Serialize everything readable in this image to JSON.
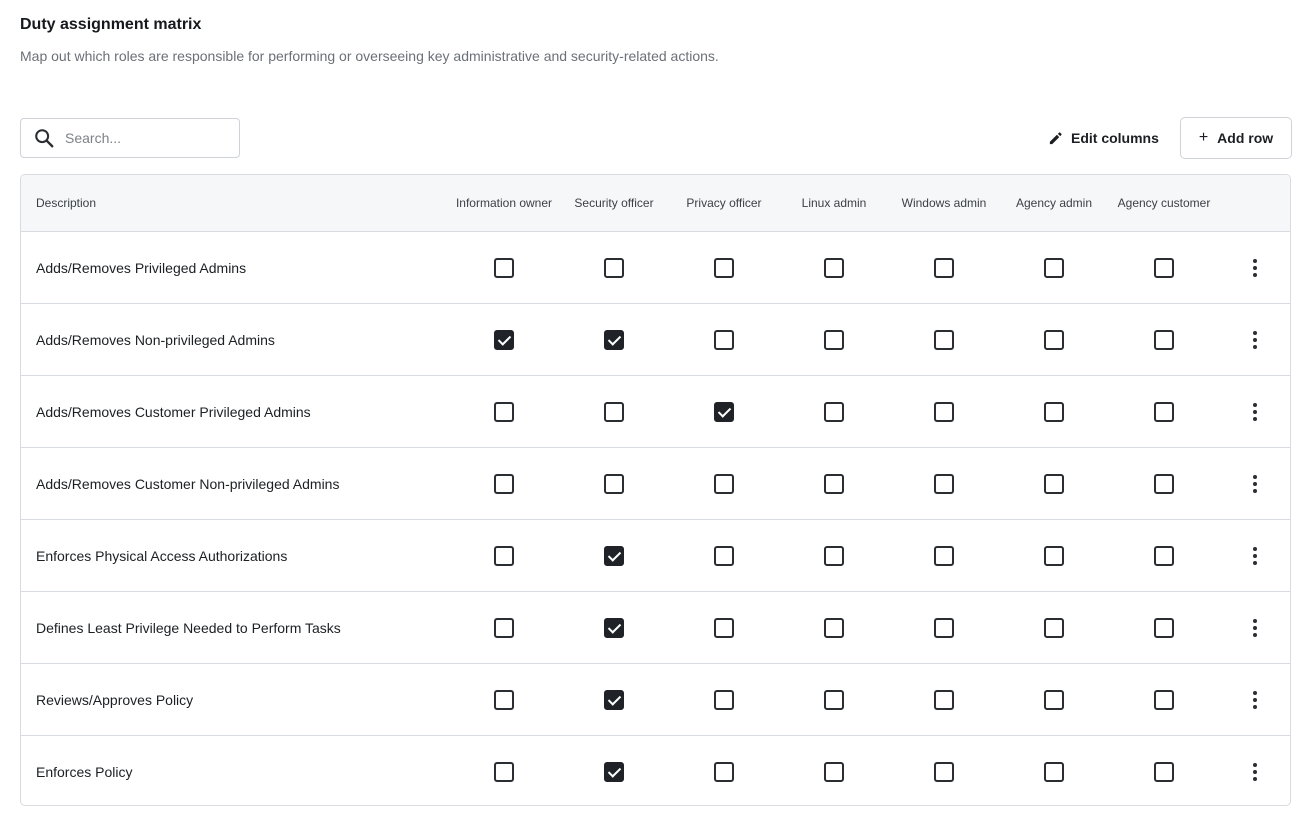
{
  "header": {
    "title": "Duty assignment matrix",
    "subtitle": "Map out which roles are responsible for performing or overseeing key administrative and security-related actions."
  },
  "toolbar": {
    "search_placeholder": "Search...",
    "search_value": "",
    "edit_columns_label": "Edit columns",
    "add_row_label": "Add row",
    "add_row_icon": "+"
  },
  "table": {
    "description_header": "Description",
    "roles": [
      "Information owner",
      "Security officer",
      "Privacy officer",
      "Linux admin",
      "Windows admin",
      "Agency admin",
      "Agency customer"
    ],
    "rows": [
      {
        "description": "Adds/Removes Privileged Admins",
        "checks": [
          false,
          false,
          false,
          false,
          false,
          false,
          false
        ]
      },
      {
        "description": "Adds/Removes Non-privileged Admins",
        "checks": [
          true,
          true,
          false,
          false,
          false,
          false,
          false
        ]
      },
      {
        "description": "Adds/Removes Customer Privileged Admins",
        "checks": [
          false,
          false,
          true,
          false,
          false,
          false,
          false
        ]
      },
      {
        "description": "Adds/Removes Customer Non-privileged Admins",
        "checks": [
          false,
          false,
          false,
          false,
          false,
          false,
          false
        ]
      },
      {
        "description": "Enforces Physical Access Authorizations",
        "checks": [
          false,
          true,
          false,
          false,
          false,
          false,
          false
        ]
      },
      {
        "description": "Defines Least Privilege Needed to Perform Tasks",
        "checks": [
          false,
          true,
          false,
          false,
          false,
          false,
          false
        ]
      },
      {
        "description": "Reviews/Approves Policy",
        "checks": [
          false,
          true,
          false,
          false,
          false,
          false,
          false
        ]
      },
      {
        "description": "Enforces Policy",
        "checks": [
          false,
          true,
          false,
          false,
          false,
          false,
          false
        ]
      }
    ]
  },
  "icons": {
    "search": "search-icon",
    "edit": "pencil-icon",
    "row_menu": "more-vertical-icon"
  },
  "colors": {
    "checked": "#1f2328",
    "border": "#d8dbdf",
    "header_bg": "#f6f7f8"
  }
}
